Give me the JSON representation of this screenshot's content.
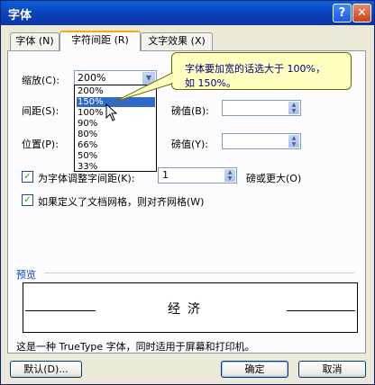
{
  "window": {
    "title": "字体",
    "help_icon": "?",
    "close_icon": "✕"
  },
  "tabs": [
    {
      "label": "字体 (N)"
    },
    {
      "label": "字符间距 (R)"
    },
    {
      "label": "文字效果 (X)"
    }
  ],
  "scale": {
    "label": "缩放(C):",
    "value": "200%",
    "options": [
      "200%",
      "150%",
      "100%",
      "90%",
      "80%",
      "66%",
      "50%",
      "33%"
    ],
    "highlighted": "150%"
  },
  "spacing": {
    "label": "间距(S):",
    "pt_label": "磅值(B):",
    "pt_value": ""
  },
  "position": {
    "label": "位置(P):",
    "pt_label": "磅值(Y):",
    "pt_value": ""
  },
  "kerning": {
    "label": "为字体调整字间距(K):",
    "value": "1",
    "suffix": "磅或更大(O)",
    "checked": true
  },
  "grid": {
    "label": "如果定义了文档网格，则对齐网格(W)",
    "checked": true
  },
  "tooltip": {
    "line1": "字体要加宽的话选大于 100%，",
    "line2": "如 150%。"
  },
  "preview": {
    "label": "预览",
    "sample": "经济",
    "description": "这是一种 TrueType 字体，同时适用于屏幕和打印机。"
  },
  "buttons": {
    "default": "默认(D)...",
    "ok": "确定",
    "cancel": "取消"
  },
  "colors": {
    "title_bar": "#0a4fd0",
    "tooltip_bg": "#ffffc0",
    "selection": "#316ac5",
    "tab_accent": "#f6a81d"
  }
}
